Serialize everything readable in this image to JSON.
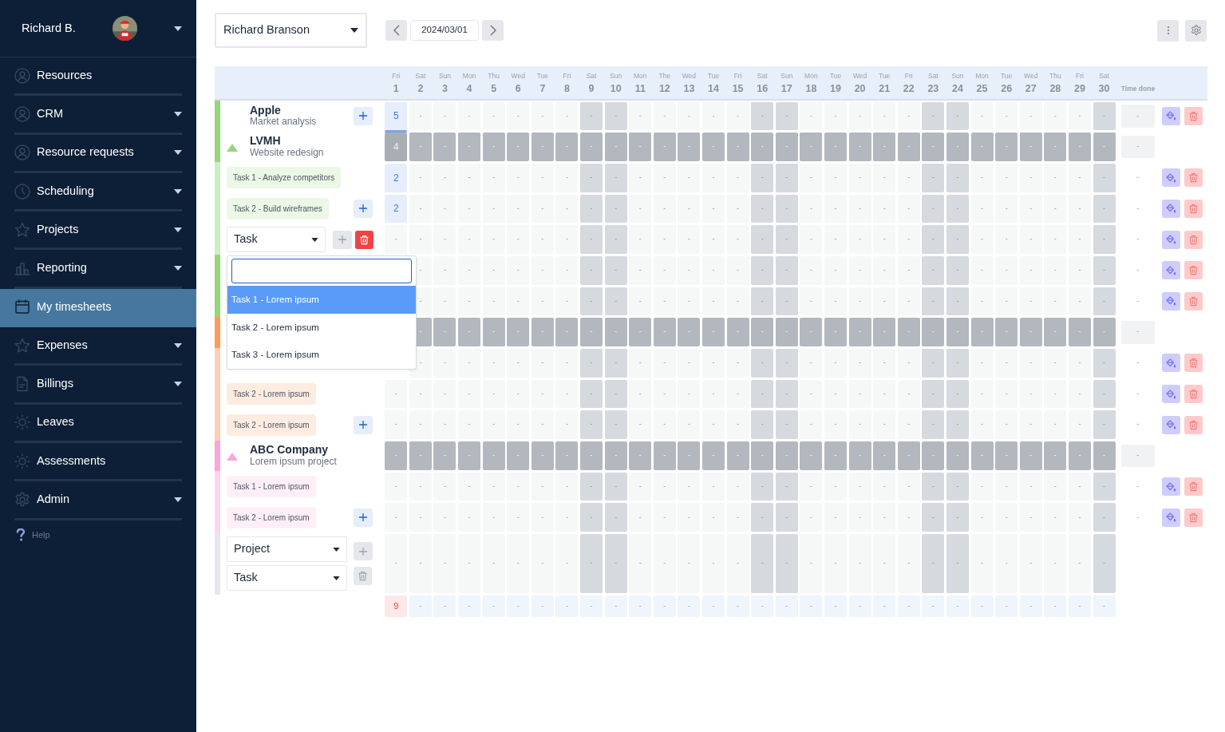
{
  "user": {
    "name": "Richard B."
  },
  "sidebar": {
    "items": [
      {
        "label": "Resources",
        "caret": false,
        "selected": false
      },
      {
        "label": "CRM",
        "caret": true,
        "selected": false
      },
      {
        "label": "Resource requests",
        "caret": true,
        "selected": false
      },
      {
        "label": "Scheduling",
        "caret": true,
        "selected": false
      },
      {
        "label": "Projects",
        "caret": true,
        "selected": false
      },
      {
        "label": "Reporting",
        "caret": true,
        "selected": false
      },
      {
        "label": "My timesheets",
        "caret": false,
        "selected": true
      },
      {
        "label": "Expenses",
        "caret": true,
        "selected": false
      },
      {
        "label": "Billings",
        "caret": true,
        "selected": false
      },
      {
        "label": "Leaves",
        "caret": false,
        "selected": false
      },
      {
        "label": "Assessments",
        "caret": false,
        "selected": false
      },
      {
        "label": "Admin",
        "caret": true,
        "selected": false
      }
    ],
    "help": "Help"
  },
  "toolbar": {
    "person_select": "Richard Branson",
    "date": "2024/03/01"
  },
  "grid": {
    "time_done_header": "Time done",
    "days": [
      {
        "weekday": "Fri",
        "day": "1",
        "weekend": false
      },
      {
        "weekday": "Sat",
        "day": "2",
        "weekend": false
      },
      {
        "weekday": "Sun",
        "day": "3",
        "weekend": false
      },
      {
        "weekday": "Mon",
        "day": "4",
        "weekend": false
      },
      {
        "weekday": "Thu",
        "day": "5",
        "weekend": false
      },
      {
        "weekday": "Wed",
        "day": "6",
        "weekend": false
      },
      {
        "weekday": "Tue",
        "day": "7",
        "weekend": false
      },
      {
        "weekday": "Fri",
        "day": "8",
        "weekend": false
      },
      {
        "weekday": "Sat",
        "day": "9",
        "weekend": true
      },
      {
        "weekday": "Sun",
        "day": "10",
        "weekend": true
      },
      {
        "weekday": "Mon",
        "day": "11",
        "weekend": false
      },
      {
        "weekday": "The",
        "day": "12",
        "weekend": false
      },
      {
        "weekday": "Wed",
        "day": "13",
        "weekend": false
      },
      {
        "weekday": "Tue",
        "day": "14",
        "weekend": false
      },
      {
        "weekday": "Fri",
        "day": "15",
        "weekend": false
      },
      {
        "weekday": "Sat",
        "day": "16",
        "weekend": true
      },
      {
        "weekday": "Sun",
        "day": "17",
        "weekend": true
      },
      {
        "weekday": "Mon",
        "day": "18",
        "weekend": false
      },
      {
        "weekday": "Tue",
        "day": "19",
        "weekend": false
      },
      {
        "weekday": "Wed",
        "day": "20",
        "weekend": false
      },
      {
        "weekday": "Tue",
        "day": "21",
        "weekend": false
      },
      {
        "weekday": "Fri",
        "day": "22",
        "weekend": false
      },
      {
        "weekday": "Sat",
        "day": "23",
        "weekend": true
      },
      {
        "weekday": "Sun",
        "day": "24",
        "weekend": true
      },
      {
        "weekday": "Mon",
        "day": "25",
        "weekend": false
      },
      {
        "weekday": "Tue",
        "day": "26",
        "weekend": false
      },
      {
        "weekday": "Wed",
        "day": "27",
        "weekend": false
      },
      {
        "weekday": "Thu",
        "day": "28",
        "weekend": false
      },
      {
        "weekday": "Fri",
        "day": "29",
        "weekend": false
      },
      {
        "weekday": "Sat",
        "day": "30",
        "weekend": true
      }
    ],
    "rows": [
      {
        "kind": "project",
        "color": "#95d67b",
        "name": "Apple",
        "description": "Market analysis",
        "triangle": false,
        "summary": false,
        "add_disabled": false,
        "first_filled": true,
        "first_selected": true,
        "time_done": "-",
        "actions": true,
        "cells": [
          "5",
          "-",
          "-",
          "-",
          "-",
          "-",
          "-",
          "-",
          "-",
          "-",
          "-",
          "-",
          "-",
          "-",
          "-",
          "-",
          "-",
          "-",
          "-",
          "-",
          "-",
          "-",
          "-",
          "-",
          "-",
          "-",
          "-",
          "-",
          "-",
          "-"
        ]
      },
      {
        "kind": "project",
        "color": "#95d67b",
        "name": "LVMH",
        "description": "Website redesign",
        "triangle": true,
        "summary": true,
        "first_filled": true,
        "time_done": "-",
        "actions": false,
        "cells": [
          "4",
          "-",
          "-",
          "-",
          "-",
          "-",
          "-",
          "-",
          "-",
          "-",
          "-",
          "-",
          "-",
          "-",
          "-",
          "-",
          "-",
          "-",
          "-",
          "-",
          "-",
          "-",
          "-",
          "-",
          "-",
          "-",
          "-",
          "-",
          "-",
          "-"
        ]
      },
      {
        "kind": "task",
        "color": "#cdeec0",
        "label": "Task 1 - Analyze competitors",
        "first_filled": true,
        "time_done": "-",
        "actions": true,
        "cells": [
          "2",
          "-",
          "-",
          "-",
          "-",
          "-",
          "-",
          "-",
          "-",
          "-",
          "-",
          "-",
          "-",
          "-",
          "-",
          "-",
          "-",
          "-",
          "-",
          "-",
          "-",
          "-",
          "-",
          "-",
          "-",
          "-",
          "-",
          "-",
          "-",
          "-"
        ]
      },
      {
        "kind": "task",
        "color": "#cdeec0",
        "label": "Task 2 - Build wireframes",
        "add_disabled": false,
        "first_filled": true,
        "time_done": "-",
        "actions": true,
        "cells": [
          "2",
          "-",
          "-",
          "-",
          "-",
          "-",
          "-",
          "-",
          "-",
          "-",
          "-",
          "-",
          "-",
          "-",
          "-",
          "-",
          "-",
          "-",
          "-",
          "-",
          "-",
          "-",
          "-",
          "-",
          "-",
          "-",
          "-",
          "-",
          "-",
          "-"
        ]
      },
      {
        "kind": "task-select",
        "color": "#cdeec0",
        "select": "Task",
        "add_disabled": true,
        "delete_disabled": false,
        "first_filled": false,
        "time_done": "-",
        "actions": true,
        "cells": [
          "-",
          "-",
          "-",
          "-",
          "-",
          "-",
          "-",
          "-",
          "-",
          "-",
          "-",
          "-",
          "-",
          "-",
          "-",
          "-",
          "-",
          "-",
          "-",
          "-",
          "-",
          "-",
          "-",
          "-",
          "-",
          "-",
          "-",
          "-",
          "-",
          "-"
        ],
        "dropdown": {
          "options": [
            {
              "label": "Task 1 - Lorem ipsum",
              "selected": true
            },
            {
              "label": "Task 2 - Lorem ipsum",
              "selected": false
            },
            {
              "label": "Task 3 - Lorem ipsum",
              "selected": false
            }
          ]
        }
      },
      {
        "kind": "task",
        "color": "#95d67b",
        "time_done": "-",
        "actions": true,
        "cells": [
          null,
          "-",
          "-",
          "-",
          "-",
          "-",
          "-",
          "-",
          "-",
          "-",
          "-",
          "-",
          "-",
          "-",
          "-",
          "-",
          "-",
          "-",
          "-",
          "-",
          "-",
          "-",
          "-",
          "-",
          "-",
          "-",
          "-",
          "-",
          "-",
          "-"
        ]
      },
      {
        "kind": "task",
        "color": "#95d67b",
        "time_done": "-",
        "actions": true,
        "cells": [
          null,
          "-",
          "-",
          "-",
          "-",
          "-",
          "-",
          "-",
          "-",
          "-",
          "-",
          "-",
          "-",
          "-",
          "-",
          "-",
          "-",
          "-",
          "-",
          "-",
          "-",
          "-",
          "-",
          "-",
          "-",
          "-",
          "-",
          "-",
          "-",
          "-"
        ]
      },
      {
        "kind": "project",
        "color": "#ff9a5c",
        "triangle": false,
        "summary": true,
        "time_done": "-",
        "actions": false,
        "cells": [
          null,
          "-",
          "-",
          "-",
          "-",
          "-",
          "-",
          "-",
          "-",
          "-",
          "-",
          "-",
          "-",
          "-",
          "-",
          "-",
          "-",
          "-",
          "-",
          "-",
          "-",
          "-",
          "-",
          "-",
          "-",
          "-",
          "-",
          "-",
          "-",
          "-"
        ]
      },
      {
        "kind": "task",
        "color": "#fdd0b5",
        "time_done": "-",
        "actions": true,
        "cells": [
          null,
          "-",
          "-",
          "-",
          "-",
          "-",
          "-",
          "-",
          "-",
          "-",
          "-",
          "-",
          "-",
          "-",
          "-",
          "-",
          "-",
          "-",
          "-",
          "-",
          "-",
          "-",
          "-",
          "-",
          "-",
          "-",
          "-",
          "-",
          "-",
          "-"
        ]
      },
      {
        "kind": "task",
        "color": "#fdd0b5",
        "label": "Task 2 - Lorem ipsum",
        "first_filled": false,
        "time_done": "-",
        "actions": true,
        "cells": [
          "-",
          "-",
          "-",
          "-",
          "-",
          "-",
          "-",
          "-",
          "-",
          "-",
          "-",
          "-",
          "-",
          "-",
          "-",
          "-",
          "-",
          "-",
          "-",
          "-",
          "-",
          "-",
          "-",
          "-",
          "-",
          "-",
          "-",
          "-",
          "-",
          "-"
        ]
      },
      {
        "kind": "task",
        "color": "#fdd0b5",
        "label": "Task 2 - Lorem ipsum",
        "add_disabled": false,
        "first_filled": false,
        "time_done": "-",
        "actions": true,
        "cells": [
          "-",
          "-",
          "-",
          "-",
          "-",
          "-",
          "-",
          "-",
          "-",
          "-",
          "-",
          "-",
          "-",
          "-",
          "-",
          "-",
          "-",
          "-",
          "-",
          "-",
          "-",
          "-",
          "-",
          "-",
          "-",
          "-",
          "-",
          "-",
          "-",
          "-"
        ]
      },
      {
        "kind": "project",
        "color": "#fba6d4",
        "name": "ABC Company",
        "description": "Lorem ipsum project",
        "triangle": true,
        "summary": true,
        "first_filled": false,
        "time_done": "-",
        "actions": false,
        "cells": [
          "-",
          "-",
          "-",
          "-",
          "-",
          "-",
          "-",
          "-",
          "-",
          "-",
          "-",
          "-",
          "-",
          "-",
          "-",
          "-",
          "-",
          "-",
          "-",
          "-",
          "-",
          "-",
          "-",
          "-",
          "-",
          "-",
          "-",
          "-",
          "-",
          "-"
        ]
      },
      {
        "kind": "task",
        "color": "#fdd6ea",
        "label": "Task 1 - Lorem ipsum",
        "first_filled": false,
        "time_done": "-",
        "actions": true,
        "cells": [
          "-",
          "-",
          "-",
          "-",
          "-",
          "-",
          "-",
          "-",
          "-",
          "-",
          "-",
          "-",
          "-",
          "-",
          "-",
          "-",
          "-",
          "-",
          "-",
          "-",
          "-",
          "-",
          "-",
          "-",
          "-",
          "-",
          "-",
          "-",
          "-",
          "-"
        ]
      },
      {
        "kind": "task",
        "color": "#fdd6ea",
        "label": "Task 2 - Lorem ipsum",
        "add_disabled": false,
        "first_filled": false,
        "time_done": "-",
        "actions": true,
        "cells": [
          "-",
          "-",
          "-",
          "-",
          "-",
          "-",
          "-",
          "-",
          "-",
          "-",
          "-",
          "-",
          "-",
          "-",
          "-",
          "-",
          "-",
          "-",
          "-",
          "-",
          "-",
          "-",
          "-",
          "-",
          "-",
          "-",
          "-",
          "-",
          "-",
          "-"
        ]
      },
      {
        "kind": "new-entry",
        "color": "#e5e7eb",
        "project_select": "Project",
        "select": "Task",
        "add_disabled": true,
        "delete_disabled": true,
        "first_filled": false,
        "actions": false,
        "cells": [
          "-",
          "-",
          "-",
          "-",
          "-",
          "-",
          "-",
          "-",
          "-",
          "-",
          "-",
          "-",
          "-",
          "-",
          "-",
          "-",
          "-",
          "-",
          "-",
          "-",
          "-",
          "-",
          "-",
          "-",
          "-",
          "-",
          "-",
          "-",
          "-",
          "-"
        ]
      },
      {
        "kind": "total",
        "first_filled": true,
        "cells": [
          "9",
          "-",
          "-",
          "-",
          "-",
          "-",
          "-",
          "-",
          "-",
          "-",
          "-",
          "-",
          "-",
          "-",
          "-",
          "-",
          "-",
          "-",
          "-",
          "-",
          "-",
          "-",
          "-",
          "-",
          "-",
          "-",
          "-",
          "-",
          "-",
          "-"
        ]
      }
    ]
  }
}
